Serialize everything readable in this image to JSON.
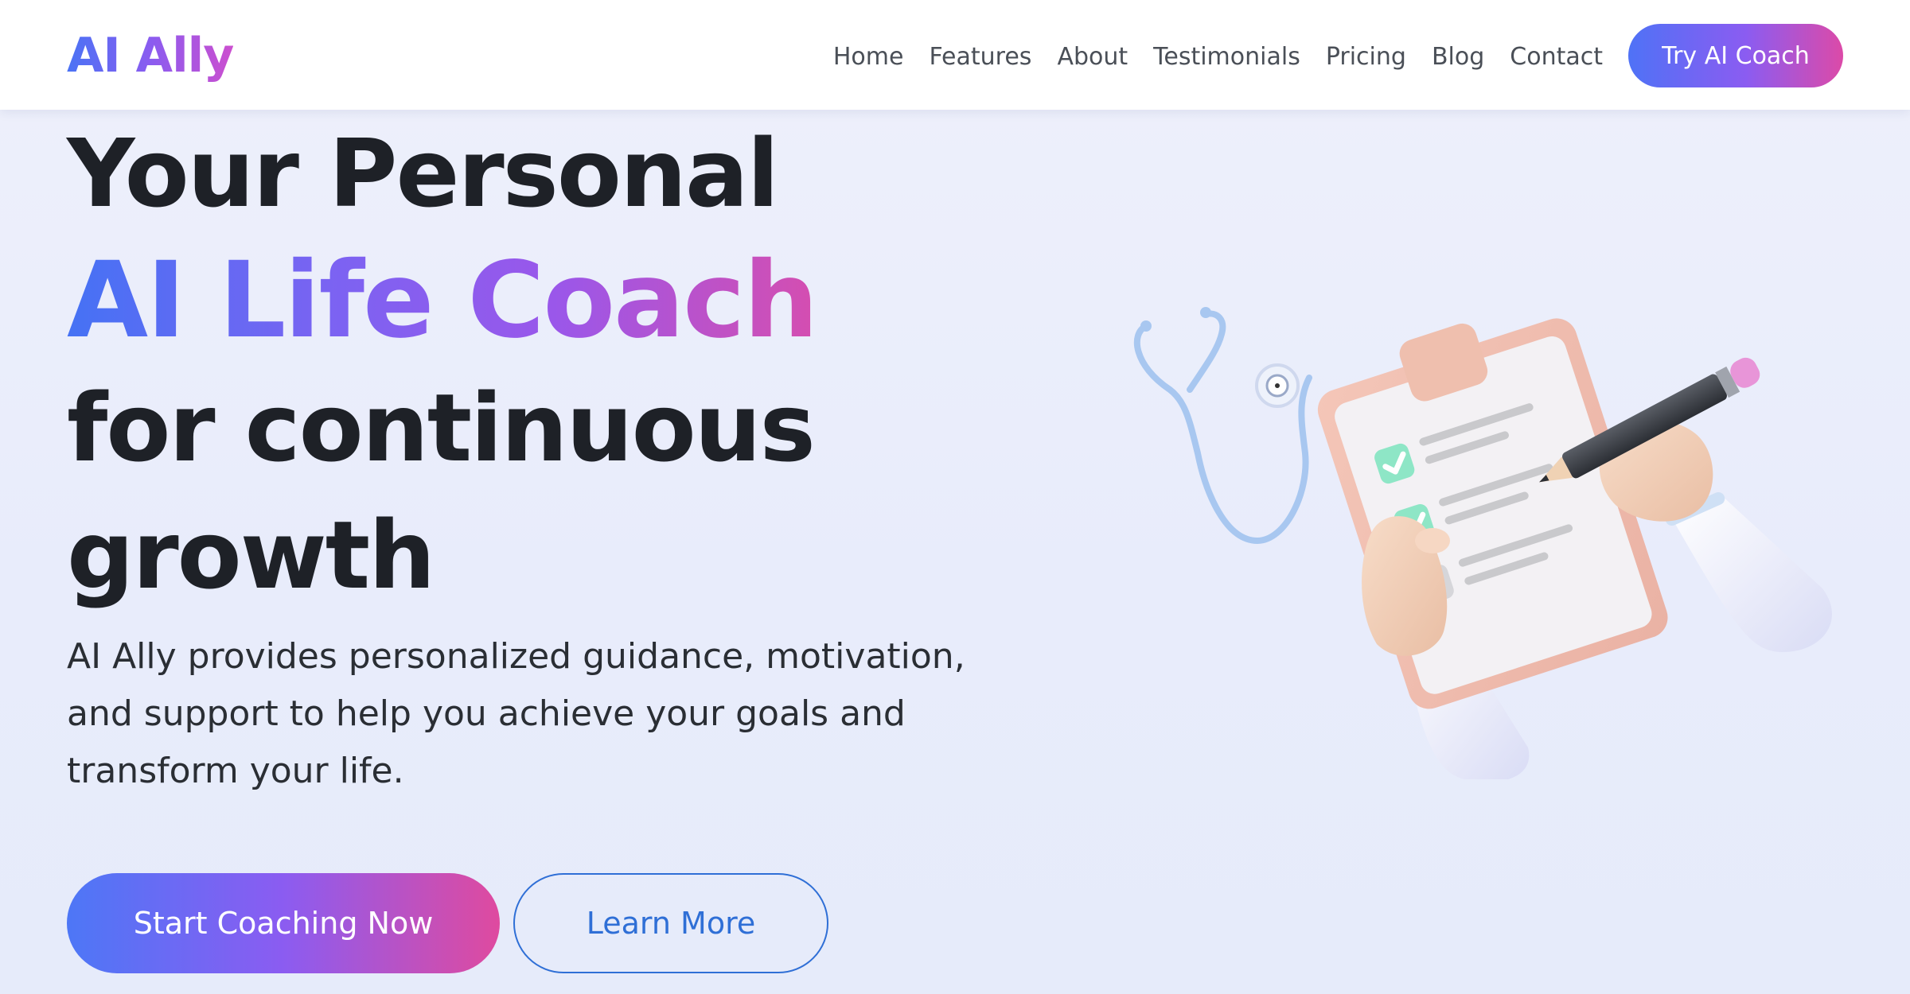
{
  "brand": {
    "name": "AI Ally"
  },
  "nav": {
    "links": [
      "Home",
      "Features",
      "About",
      "Testimonials",
      "Pricing",
      "Blog",
      "Contact"
    ],
    "cta_label": "Try AI Coach"
  },
  "hero": {
    "title_line1": "Your Personal",
    "title_highlight": "AI Life Coach",
    "title_line3": "for continuous",
    "title_line4": "growth",
    "subtitle": "AI Ally provides personalized guidance, motivation, and support to help you achieve your goals and transform your life.",
    "primary_button": "Start Coaching Now",
    "secondary_button": "Learn More"
  },
  "colors": {
    "gradient_start": "#4a73f5",
    "gradient_mid": "#8b5cf1",
    "gradient_end": "#dc4aa8",
    "secondary_accent": "#2f6fd6",
    "background": "#e9edfb"
  },
  "icons": {
    "illustration": "clipboard-checklist-stethoscope-illustration"
  }
}
